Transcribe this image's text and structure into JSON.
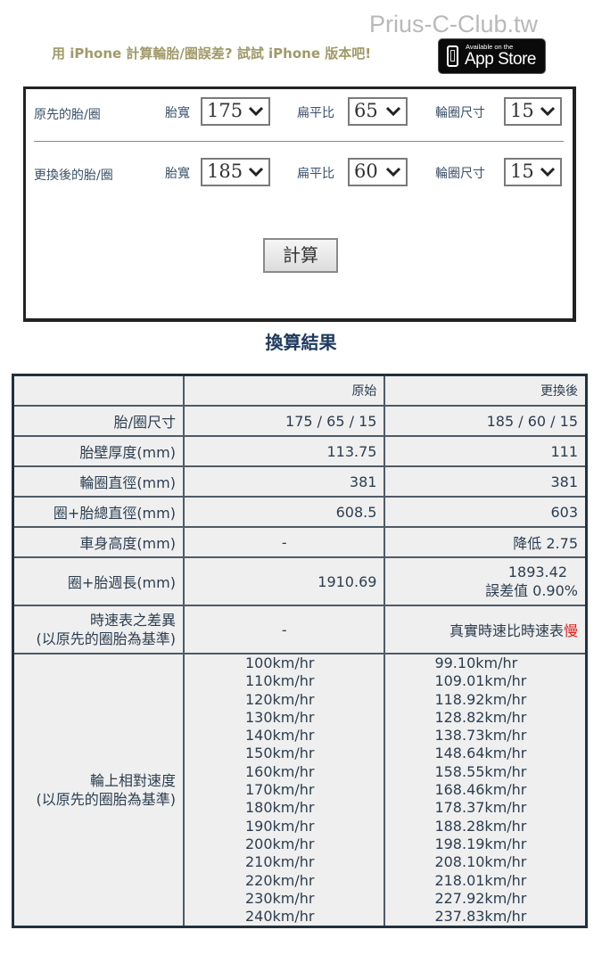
{
  "watermark": "Prius-C-Club.tw",
  "promo": {
    "text": "用 iPhone 計算輪胎/圈誤差? 試試 iPhone 版本吧!",
    "badge_small": "Available on the",
    "badge_big": "App Store",
    "badge_icon": "iphone-icon"
  },
  "form": {
    "original": {
      "label": "原先的胎/圈",
      "width_label": "胎寬",
      "width_value": "175",
      "ratio_label": "扁平比",
      "ratio_value": "65",
      "rim_label": "輪圈尺寸",
      "rim_value": "15"
    },
    "new": {
      "label": "更換後的胎/圈",
      "width_label": "胎寬",
      "width_value": "185",
      "ratio_label": "扁平比",
      "ratio_value": "60",
      "rim_label": "輪圈尺寸",
      "rim_value": "15"
    },
    "calculate_button": "計算"
  },
  "result": {
    "title": "換算結果",
    "headers": [
      "",
      "原始",
      "更換後"
    ],
    "rows": [
      {
        "label": "胎/圈尺寸",
        "original": "175 / 65 / 15",
        "new": "185 / 60 / 15"
      },
      {
        "label": "胎壁厚度(mm)",
        "original": "113.75",
        "new": "111"
      },
      {
        "label": "輪圈直徑(mm)",
        "original": "381",
        "new": "381"
      },
      {
        "label": "圈+胎總直徑(mm)",
        "original": "608.5",
        "new": "603"
      },
      {
        "label": "車身高度(mm)",
        "original": "-",
        "new": "降低 2.75"
      },
      {
        "label": "圈+胎週長(mm)",
        "original": "1910.69",
        "new": "1893.42",
        "new_note": "誤差值 0.90%"
      }
    ],
    "speedometer": {
      "label_line1": "時速表之差異",
      "label_line2": "(以原先的圈胎為基準)",
      "original": "-",
      "new_prefix": "真實時速比時速表",
      "new_highlight": "慢"
    },
    "relative_speed": {
      "label_line1": "輪上相對速度",
      "label_line2": "(以原先的圈胎為基準)",
      "original": [
        "100km/hr",
        "110km/hr",
        "120km/hr",
        "130km/hr",
        "140km/hr",
        "150km/hr",
        "160km/hr",
        "170km/hr",
        "180km/hr",
        "190km/hr",
        "200km/hr",
        "210km/hr",
        "220km/hr",
        "230km/hr",
        "240km/hr"
      ],
      "new": [
        "99.10km/hr",
        "109.01km/hr",
        "118.92km/hr",
        "128.82km/hr",
        "138.73km/hr",
        "148.64km/hr",
        "158.55km/hr",
        "168.46km/hr",
        "178.37km/hr",
        "188.28km/hr",
        "198.19km/hr",
        "208.10km/hr",
        "218.01km/hr",
        "227.92km/hr",
        "237.83km/hr"
      ]
    }
  }
}
